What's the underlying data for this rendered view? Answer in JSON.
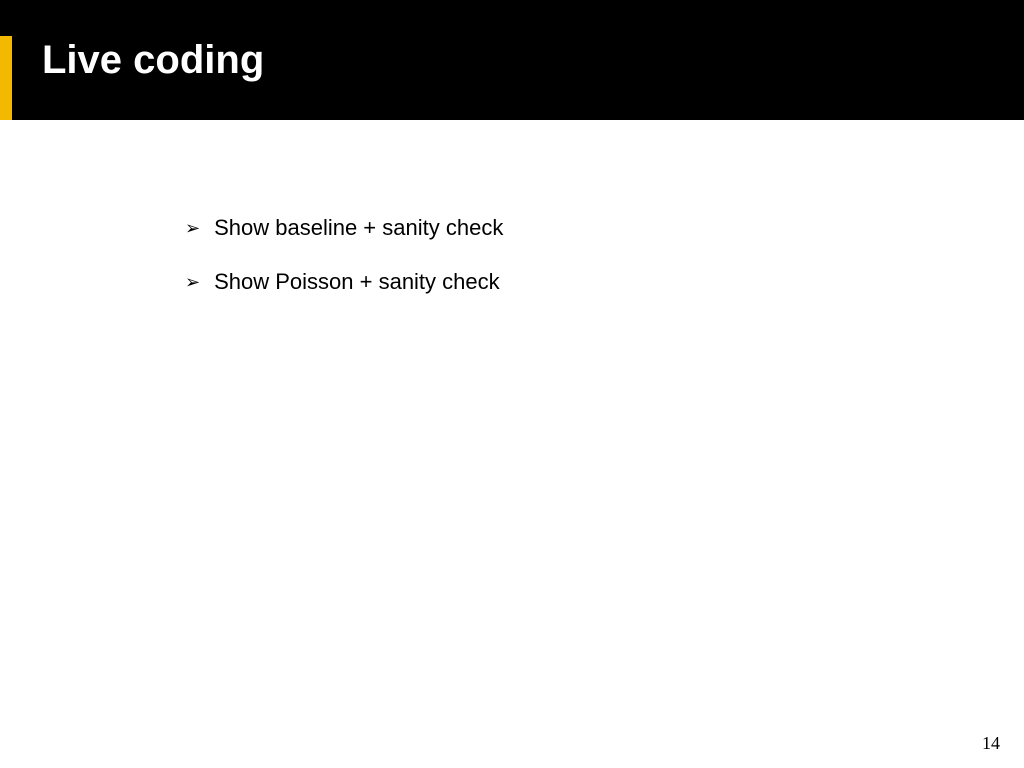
{
  "title": "Live coding",
  "bullets": [
    {
      "text": "Show baseline + sanity check"
    },
    {
      "text": "Show Poisson + sanity check"
    }
  ],
  "page_number": "14",
  "colors": {
    "accent": "#f2b900",
    "header_bg": "#000000",
    "header_fg": "#ffffff"
  }
}
